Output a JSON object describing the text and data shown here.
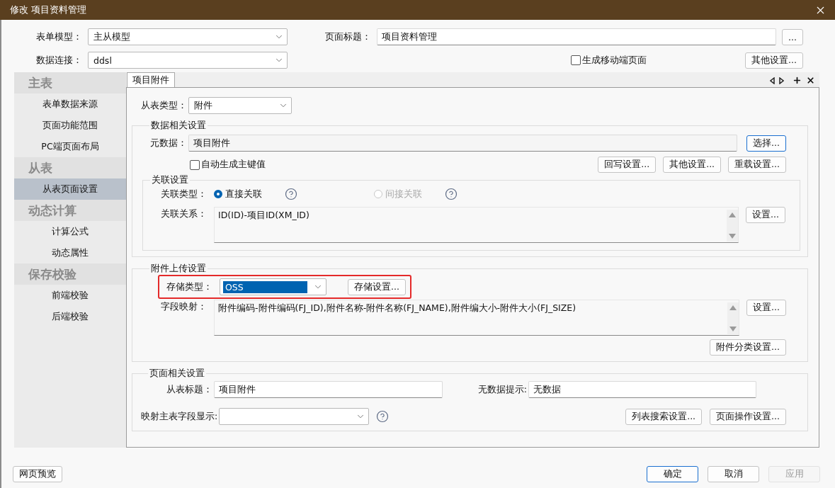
{
  "window": {
    "title": "修改 项目资料管理"
  },
  "header": {
    "form_model": {
      "label": "表单模型：",
      "value": "主从模型"
    },
    "data_connection": {
      "label": "数据连接：",
      "value": "ddsl"
    },
    "page_title": {
      "label": "页面标题：",
      "value": "项目资料管理"
    },
    "browse_button": {
      "label": "..."
    },
    "mobile_page": {
      "label": "生成移动端页面",
      "checked": false
    },
    "other_settings_button": {
      "label": "其他设置..."
    }
  },
  "sidebar": {
    "groups": [
      {
        "title": "主表",
        "items": [
          {
            "label": "表单数据来源",
            "selected": false
          },
          {
            "label": "页面功能范围",
            "selected": false
          },
          {
            "label": "PC端页面布局",
            "selected": false
          }
        ]
      },
      {
        "title": "从表",
        "items": [
          {
            "label": "从表页面设置",
            "selected": true
          }
        ]
      },
      {
        "title": "动态计算",
        "items": [
          {
            "label": "计算公式",
            "selected": false
          },
          {
            "label": "动态属性",
            "selected": false
          }
        ]
      },
      {
        "title": "保存校验",
        "items": [
          {
            "label": "前端校验",
            "selected": false
          },
          {
            "label": "后端校验",
            "selected": false
          }
        ]
      }
    ]
  },
  "tabs": [
    {
      "label": "项目附件",
      "selected": true
    }
  ],
  "detail": {
    "sub_table_type": {
      "label": "从表类型：",
      "value": "附件"
    },
    "data_settings": {
      "title": "数据相关设置",
      "metadata": {
        "label": "元数据：",
        "value": "项目附件",
        "button": {
          "label": "选择...",
          "focused": true
        }
      },
      "auto_key": {
        "label": "自动生成主键值",
        "checked": false
      },
      "buttons": [
        {
          "label": "回写设置...",
          "focused": false
        },
        {
          "label": "其他设置...",
          "focused": false
        },
        {
          "label": "重载设置...",
          "focused": false
        }
      ],
      "relation": {
        "title": "关联设置",
        "type_label": "关联类型：",
        "options": [
          {
            "label": "直接关联",
            "selected": true,
            "disabled": false
          },
          {
            "label": "间接关联",
            "selected": false,
            "disabled": true
          }
        ],
        "relation_label": "关联关系：",
        "relation_value": "ID(ID)-项目ID(XM_ID)",
        "button": {
          "label": "设置...",
          "focused": false
        }
      }
    },
    "upload_settings": {
      "title": "附件上传设置",
      "callout": true,
      "storage_type": {
        "label": "存储类型：",
        "value": "OSS",
        "highlighted": true
      },
      "storage_button": {
        "label": "存储设置...",
        "focused": false
      },
      "mapping_label": "字段映射：",
      "mapping_value": "附件编码-附件编码(FJ_ID),附件名称-附件名称(FJ_NAME),附件编大小-附件大小(FJ_SIZE)",
      "mapping_button": {
        "label": "设置...",
        "focused": false
      },
      "category_button": {
        "label": "附件分类设置...",
        "focused": false
      }
    },
    "page_settings": {
      "title": "页面相关设置",
      "sub_title": {
        "label": "从表标题：",
        "value": "项目附件"
      },
      "empty_hint": {
        "label": "无数据提示:",
        "value": "无数据"
      },
      "map_field": {
        "label": "映射主表字段显示:"
      },
      "buttons": [
        {
          "label": "列表搜索设置...",
          "focused": false
        },
        {
          "label": "页面操作设置...",
          "focused": false
        }
      ]
    }
  },
  "footer": {
    "preview_button": {
      "label": "网页预览",
      "focused": false,
      "disabled": false
    },
    "buttons": [
      {
        "label": "确定",
        "focused": true,
        "disabled": false
      },
      {
        "label": "取消",
        "focused": false,
        "disabled": false
      },
      {
        "label": "应用",
        "focused": false,
        "disabled": true
      }
    ]
  }
}
